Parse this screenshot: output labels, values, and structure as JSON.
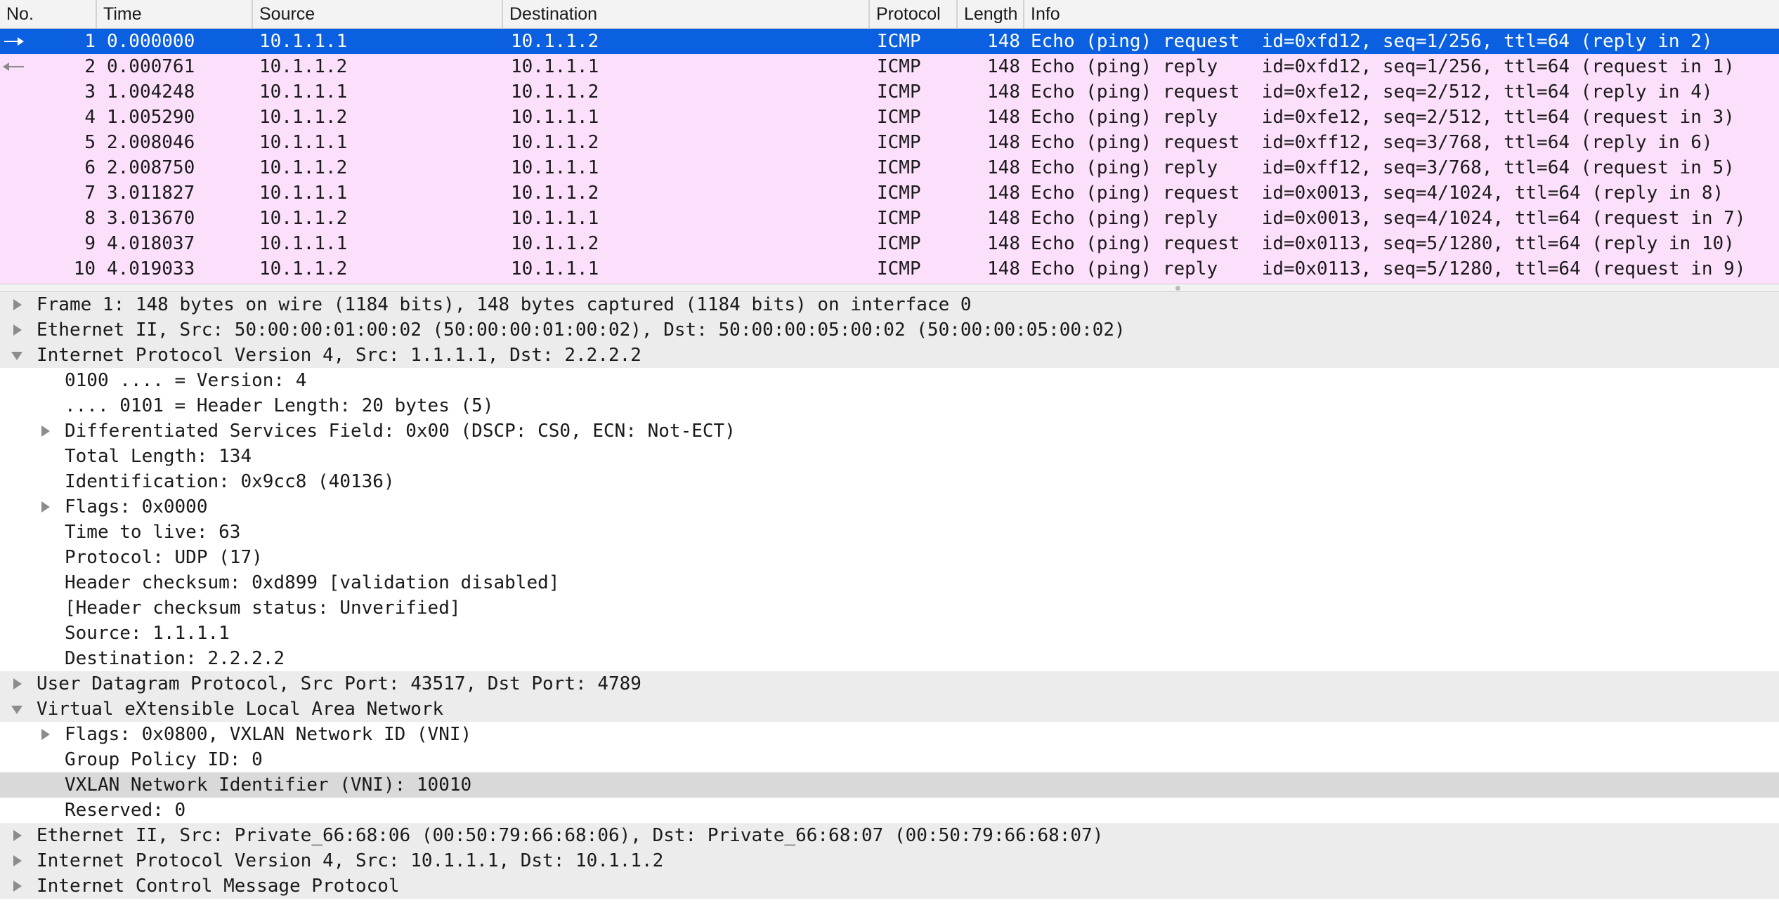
{
  "columns": [
    "No.",
    "Time",
    "Source",
    "Destination",
    "Protocol",
    "Length",
    "Info"
  ],
  "packets": [
    {
      "no": "1",
      "time": "0.000000",
      "source": "10.1.1.1",
      "destination": "10.1.1.2",
      "protocol": "ICMP",
      "length": "148",
      "info": "Echo (ping) request  id=0xfd12, seq=1/256, ttl=64 (reply in 2)"
    },
    {
      "no": "2",
      "time": "0.000761",
      "source": "10.1.1.2",
      "destination": "10.1.1.1",
      "protocol": "ICMP",
      "length": "148",
      "info": "Echo (ping) reply    id=0xfd12, seq=1/256, ttl=64 (request in 1)"
    },
    {
      "no": "3",
      "time": "1.004248",
      "source": "10.1.1.1",
      "destination": "10.1.1.2",
      "protocol": "ICMP",
      "length": "148",
      "info": "Echo (ping) request  id=0xfe12, seq=2/512, ttl=64 (reply in 4)"
    },
    {
      "no": "4",
      "time": "1.005290",
      "source": "10.1.1.2",
      "destination": "10.1.1.1",
      "protocol": "ICMP",
      "length": "148",
      "info": "Echo (ping) reply    id=0xfe12, seq=2/512, ttl=64 (request in 3)"
    },
    {
      "no": "5",
      "time": "2.008046",
      "source": "10.1.1.1",
      "destination": "10.1.1.2",
      "protocol": "ICMP",
      "length": "148",
      "info": "Echo (ping) request  id=0xff12, seq=3/768, ttl=64 (reply in 6)"
    },
    {
      "no": "6",
      "time": "2.008750",
      "source": "10.1.1.2",
      "destination": "10.1.1.1",
      "protocol": "ICMP",
      "length": "148",
      "info": "Echo (ping) reply    id=0xff12, seq=3/768, ttl=64 (request in 5)"
    },
    {
      "no": "7",
      "time": "3.011827",
      "source": "10.1.1.1",
      "destination": "10.1.1.2",
      "protocol": "ICMP",
      "length": "148",
      "info": "Echo (ping) request  id=0x0013, seq=4/1024, ttl=64 (reply in 8)"
    },
    {
      "no": "8",
      "time": "3.013670",
      "source": "10.1.1.2",
      "destination": "10.1.1.1",
      "protocol": "ICMP",
      "length": "148",
      "info": "Echo (ping) reply    id=0x0013, seq=4/1024, ttl=64 (request in 7)"
    },
    {
      "no": "9",
      "time": "4.018037",
      "source": "10.1.1.1",
      "destination": "10.1.1.2",
      "protocol": "ICMP",
      "length": "148",
      "info": "Echo (ping) request  id=0x0113, seq=5/1280, ttl=64 (reply in 10)"
    },
    {
      "no": "10",
      "time": "4.019033",
      "source": "10.1.1.2",
      "destination": "10.1.1.1",
      "protocol": "ICMP",
      "length": "148",
      "info": "Echo (ping) reply    id=0x0113, seq=5/1280, ttl=64 (request in 9)"
    }
  ],
  "details": [
    {
      "text": "Frame 1: 148 bytes on wire (1184 bits), 148 bytes captured (1184 bits) on interface 0",
      "level": 0,
      "toggle": "collapsed"
    },
    {
      "text": "Ethernet II, Src: 50:00:00:01:00:02 (50:00:00:01:00:02), Dst: 50:00:00:05:00:02 (50:00:00:05:00:02)",
      "level": 0,
      "toggle": "collapsed"
    },
    {
      "text": "Internet Protocol Version 4, Src: 1.1.1.1, Dst: 2.2.2.2",
      "level": 0,
      "toggle": "expanded"
    },
    {
      "text": "0100 .... = Version: 4",
      "level": 1,
      "toggle": "none"
    },
    {
      "text": ".... 0101 = Header Length: 20 bytes (5)",
      "level": 1,
      "toggle": "none"
    },
    {
      "text": "Differentiated Services Field: 0x00 (DSCP: CS0, ECN: Not-ECT)",
      "level": 1,
      "toggle": "collapsed"
    },
    {
      "text": "Total Length: 134",
      "level": 1,
      "toggle": "none"
    },
    {
      "text": "Identification: 0x9cc8 (40136)",
      "level": 1,
      "toggle": "none"
    },
    {
      "text": "Flags: 0x0000",
      "level": 1,
      "toggle": "collapsed"
    },
    {
      "text": "Time to live: 63",
      "level": 1,
      "toggle": "none"
    },
    {
      "text": "Protocol: UDP (17)",
      "level": 1,
      "toggle": "none"
    },
    {
      "text": "Header checksum: 0xd899 [validation disabled]",
      "level": 1,
      "toggle": "none"
    },
    {
      "text": "[Header checksum status: Unverified]",
      "level": 1,
      "toggle": "none"
    },
    {
      "text": "Source: 1.1.1.1",
      "level": 1,
      "toggle": "none"
    },
    {
      "text": "Destination: 2.2.2.2",
      "level": 1,
      "toggle": "none"
    },
    {
      "text": "User Datagram Protocol, Src Port: 43517, Dst Port: 4789",
      "level": 0,
      "toggle": "collapsed"
    },
    {
      "text": "Virtual eXtensible Local Area Network",
      "level": 0,
      "toggle": "expanded"
    },
    {
      "text": "Flags: 0x0800, VXLAN Network ID (VNI)",
      "level": 1,
      "toggle": "collapsed"
    },
    {
      "text": "Group Policy ID: 0",
      "level": 1,
      "toggle": "none"
    },
    {
      "text": "VXLAN Network Identifier (VNI): 10010",
      "level": 1,
      "toggle": "none",
      "highlighted": true
    },
    {
      "text": "Reserved: 0",
      "level": 1,
      "toggle": "none"
    },
    {
      "text": "Ethernet II, Src: Private_66:68:06 (00:50:79:66:68:06), Dst: Private_66:68:07 (00:50:79:66:68:07)",
      "level": 0,
      "toggle": "collapsed"
    },
    {
      "text": "Internet Protocol Version 4, Src: 10.1.1.1, Dst: 10.1.1.2",
      "level": 0,
      "toggle": "collapsed"
    },
    {
      "text": "Internet Control Message Protocol",
      "level": 0,
      "toggle": "collapsed"
    }
  ],
  "colors": {
    "selected_row": "#0a60e0",
    "icmp_row": "#fce0fb",
    "header_bg": "#f3f3f3",
    "tree_top_level_bg": "#ececec",
    "tree_highlight_bg": "#d9d9d9"
  },
  "icons": {
    "selected_marker": "arrow-right-icon",
    "related_marker": "arrow-left-icon",
    "collapsed": "disclosure-triangle-right-icon",
    "expanded": "disclosure-triangle-down-icon"
  }
}
